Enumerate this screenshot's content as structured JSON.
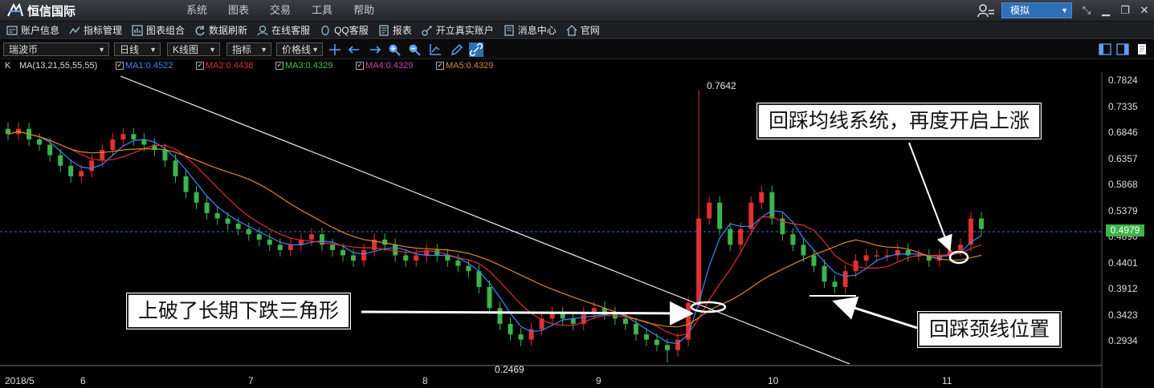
{
  "app": {
    "title": "恒信国际",
    "menu": [
      "系统",
      "图表",
      "交易",
      "工具",
      "帮助"
    ],
    "mode": "模拟"
  },
  "toolbar": {
    "items": [
      {
        "label": "账户信息",
        "icon": "account-icon"
      },
      {
        "label": "指标管理",
        "icon": "indicator-icon"
      },
      {
        "label": "图表组合",
        "icon": "chart-combo-icon"
      },
      {
        "label": "数据刷新",
        "icon": "refresh-icon"
      },
      {
        "label": "在线客服",
        "icon": "support-icon"
      },
      {
        "label": "QQ客服",
        "icon": "qq-icon"
      },
      {
        "label": "报表",
        "icon": "report-icon"
      },
      {
        "label": "开立真实账户",
        "icon": "open-account-icon"
      },
      {
        "label": "消息中心",
        "icon": "message-icon"
      },
      {
        "label": "官网",
        "icon": "home-icon"
      }
    ]
  },
  "controls": {
    "symbol": "瑞波币",
    "period": "日线",
    "chart_type": "K线图",
    "indicator": "指标",
    "price_line": "价格线"
  },
  "legend": {
    "prefix": "K",
    "ma_params": "MA(13,21,55,55,55)",
    "ma": [
      {
        "label": "MA1:0.4522",
        "color": "#3a8bff"
      },
      {
        "label": "MA2:0.4438",
        "color": "#e23232"
      },
      {
        "label": "MA3:0.4329",
        "color": "#3dcc3d"
      },
      {
        "label": "MA4:0.4329",
        "color": "#d040c0"
      },
      {
        "label": "MA5:0.4329",
        "color": "#d98a2b"
      }
    ]
  },
  "colors": {
    "up": "#e03030",
    "down": "#3bb54a",
    "ma1": "#3a8bff",
    "ma2": "#e03030",
    "ma3": "#d98a2b",
    "price_line": "#3b6fd6",
    "trendline": "#ffffff"
  },
  "axis": {
    "y_labels": [
      "0.7824",
      "0.7335",
      "0.6846",
      "0.6357",
      "0.5868",
      "0.5379",
      "0.4890",
      "0.4401",
      "0.3912",
      "0.3423",
      "0.2934"
    ],
    "x_labels": [
      "2018/5",
      "6",
      "7",
      "8",
      "9",
      "10",
      "11"
    ],
    "current_price": "0.4979",
    "high_label": "0.7642",
    "low_label": "0.2469"
  },
  "annotations": {
    "pullback_ma": "回踩均线系统，再度开启上涨",
    "breakout": "上破了长期下跌三角形",
    "neckline": "回踩颈线位置"
  },
  "chart_data": {
    "type": "candlestick",
    "ylim": [
      0.2469,
      0.7824
    ],
    "current_price": 0.4979,
    "high": 0.7642,
    "low": 0.2469,
    "months": [
      "2018/5",
      "6",
      "7",
      "8",
      "9",
      "10",
      "11"
    ],
    "close_series": [
      0.68,
      0.69,
      0.67,
      0.66,
      0.64,
      0.62,
      0.6,
      0.61,
      0.63,
      0.65,
      0.67,
      0.68,
      0.67,
      0.66,
      0.65,
      0.63,
      0.6,
      0.57,
      0.55,
      0.53,
      0.52,
      0.51,
      0.5,
      0.49,
      0.48,
      0.47,
      0.46,
      0.47,
      0.48,
      0.49,
      0.47,
      0.46,
      0.45,
      0.44,
      0.46,
      0.48,
      0.47,
      0.45,
      0.44,
      0.45,
      0.46,
      0.45,
      0.44,
      0.43,
      0.42,
      0.39,
      0.35,
      0.32,
      0.3,
      0.29,
      0.31,
      0.33,
      0.34,
      0.33,
      0.32,
      0.34,
      0.35,
      0.34,
      0.33,
      0.32,
      0.3,
      0.29,
      0.28,
      0.27,
      0.29,
      0.36,
      0.52,
      0.55,
      0.5,
      0.47,
      0.5,
      0.55,
      0.57,
      0.52,
      0.49,
      0.47,
      0.45,
      0.43,
      0.4,
      0.39,
      0.42,
      0.44,
      0.45,
      0.45,
      0.45,
      0.46,
      0.45,
      0.45,
      0.44,
      0.45,
      0.46,
      0.47,
      0.52,
      0.5
    ]
  }
}
